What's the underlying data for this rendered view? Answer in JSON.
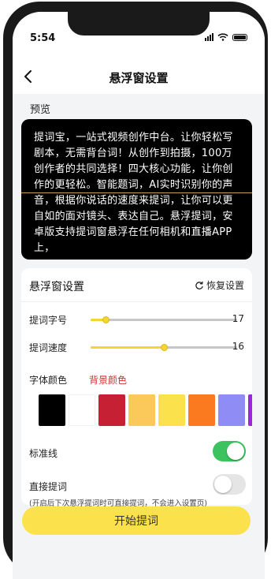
{
  "status_bar": {
    "time": "5:54"
  },
  "nav": {
    "title": "悬浮窗设置"
  },
  "preview": {
    "label": "预览",
    "text": "提词宝，一站式视频创作中台。让你轻松写剧本，无需背台词！从创作到拍摄，100万创作者的共同选择！四大核心功能，让你创作的更轻松。智能题词，AI实时识别你的声音，根据你说话的速度来提词，让你可以更自如的面对镜头、表达自己。悬浮提词，安卓版支持提词窗悬浮在任何相机和直播APP上，"
  },
  "settings": {
    "title": "悬浮窗设置",
    "restore_label": "恢复设置",
    "font_size": {
      "label": "提词字号",
      "value": "17",
      "fraction": 0.1
    },
    "speed": {
      "label": "提词速度",
      "value": "16",
      "fraction": 0.5
    },
    "color_tabs": {
      "font": "字体颜色",
      "background": "背景颜色",
      "active": "background",
      "active_color": "#d32f2f"
    },
    "swatches": [
      "#000000",
      "#ffffff",
      "#c62034",
      "#fbc85a",
      "#fbe14b",
      "#fb7a1f",
      "#8f8cf5",
      "#9c27d6"
    ],
    "guideline": {
      "label": "标准线",
      "on": true
    },
    "direct": {
      "label": "直接提词",
      "on": false,
      "hint": "(开启后下次悬浮提词时可直接提词，不会进入设置页)"
    }
  },
  "start_button": {
    "label": "开始提词"
  },
  "colors": {
    "accent": "#fbe14b",
    "toggle_on": "#3cc35f",
    "toggle_off": "#e5e5e5"
  }
}
